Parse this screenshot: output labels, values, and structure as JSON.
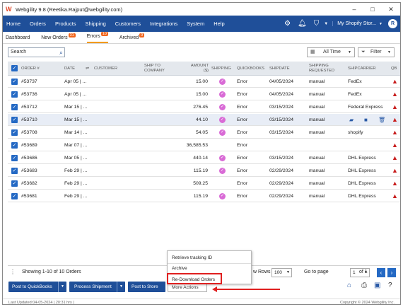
{
  "window": {
    "title": "Webgility 9.8 (Reetika.Rajput@webgility.com)",
    "minimize": "–",
    "maximize": "□",
    "close": "✕"
  },
  "menu": {
    "items": [
      "Home",
      "Orders",
      "Products",
      "Shipping",
      "Customers",
      "Integrations",
      "System",
      "Help"
    ],
    "store": "My Shopify Stor...",
    "avatar": "R"
  },
  "tabs": [
    {
      "label": "Dashboard",
      "badge": ""
    },
    {
      "label": "New Orders",
      "badge": "31"
    },
    {
      "label": "Errors",
      "badge": "10"
    },
    {
      "label": "Archived",
      "badge": "9"
    }
  ],
  "toolbar": {
    "search_placeholder": "Search",
    "date_filter": "All Time",
    "filter_label": "Filter"
  },
  "table": {
    "headers": {
      "order": "ORDER #",
      "date": "DATE",
      "customer": "CUSTOMER",
      "ship_to": "SHIP TO COMPANY",
      "amount": "AMOUNT ($)",
      "shipping": "SHIPPING",
      "quickbooks": "QUICKBOOKS",
      "shipdate": "SHIPDATE",
      "shipping_requested": "SHIPPING REQUESTED",
      "shipcarrier": "SHIPCARRIER",
      "qb": "QB"
    },
    "rows": [
      {
        "order": "#53737",
        "date": "Apr 05 | ...",
        "amount": "15.00",
        "qb": "Error",
        "shipdate": "04/05/2024",
        "req": "manual",
        "carrier": "FedEx",
        "shipping_icon": true
      },
      {
        "order": "#53736",
        "date": "Apr 05 | ...",
        "amount": "15.00",
        "qb": "Error",
        "shipdate": "04/05/2024",
        "req": "manual",
        "carrier": "FedEx",
        "shipping_icon": true
      },
      {
        "order": "#53712",
        "date": "Mar 15 | ...",
        "amount": "276.45",
        "qb": "Error",
        "shipdate": "03/15/2024",
        "req": "manual",
        "carrier": "Federal Express",
        "shipping_icon": true
      },
      {
        "order": "#53710",
        "date": "Mar 15 | ...",
        "amount": "44.10",
        "qb": "Error",
        "shipdate": "03/15/2024",
        "req": "manual",
        "carrier": "",
        "shipping_icon": true
      },
      {
        "order": "#53708",
        "date": "Mar 14 | ...",
        "amount": "54.05",
        "qb": "Error",
        "shipdate": "03/15/2024",
        "req": "manual",
        "carrier": "shopify",
        "shipping_icon": true
      },
      {
        "order": "#53689",
        "date": "Mar 07 | ...",
        "amount": "36,585.53",
        "qb": "Error",
        "shipdate": "",
        "req": "",
        "carrier": "",
        "shipping_icon": false
      },
      {
        "order": "#53686",
        "date": "Mar 05 | ...",
        "amount": "440.14",
        "qb": "Error",
        "shipdate": "03/15/2024",
        "req": "manual",
        "carrier": "DHL Express",
        "shipping_icon": true
      },
      {
        "order": "#53683",
        "date": "Feb 29 | ...",
        "amount": "115.19",
        "qb": "Error",
        "shipdate": "02/29/2024",
        "req": "manual",
        "carrier": "DHL Express",
        "shipping_icon": true
      },
      {
        "order": "#53682",
        "date": "Feb 29 | ...",
        "amount": "509.25",
        "qb": "Error",
        "shipdate": "02/29/2024",
        "req": "manual",
        "carrier": "DHL Express",
        "shipping_icon": false
      },
      {
        "order": "#53681",
        "date": "Feb 29 | ...",
        "amount": "115.19",
        "qb": "Error",
        "shipdate": "02/29/2024",
        "req": "manual",
        "carrier": "DHL Express",
        "shipping_icon": true
      }
    ]
  },
  "pager": {
    "showing": "Showing 1-10 of 10 Orders",
    "rows_label": "w Rows",
    "rows_value": "100",
    "goto_label": "Go to page",
    "page_value": "1",
    "of_label": "of 1"
  },
  "actions": {
    "post_qb": "Post to QuickBooks",
    "process_shipment": "Process Shipment",
    "post_store": "Post to Store",
    "more_actions": "More Actions"
  },
  "popup": {
    "items": [
      "Retrieve tracking ID",
      "Archive",
      "Re-Download Orders"
    ]
  },
  "status": {
    "left": "Last Updated:04-05-2024 | 20:31 hrs |",
    "right": "Copyright © 2024 Webgility Inc."
  }
}
